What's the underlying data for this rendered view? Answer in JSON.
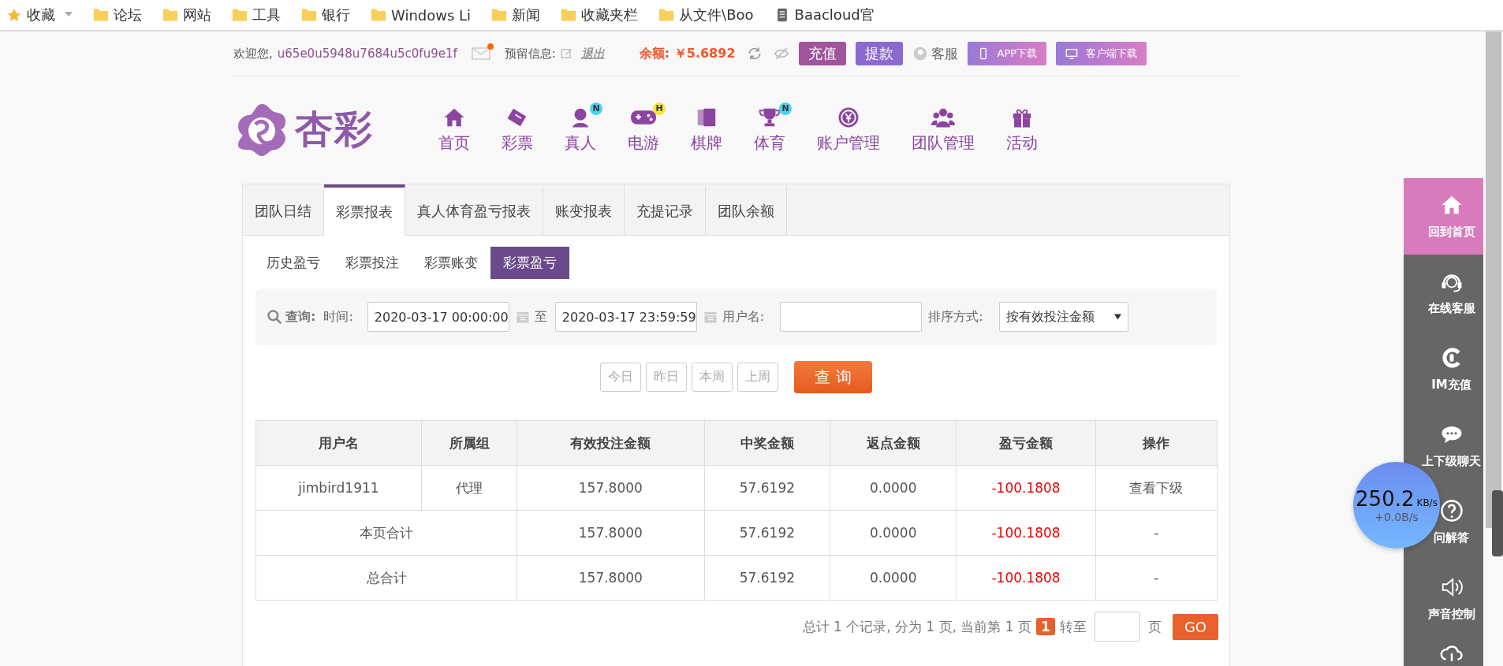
{
  "bookmarks_bar": {
    "items": [
      {
        "label": "收藏",
        "kind": "star"
      },
      {
        "label": "论坛",
        "kind": "folder"
      },
      {
        "label": "网站",
        "kind": "folder"
      },
      {
        "label": "工具",
        "kind": "folder"
      },
      {
        "label": "银行",
        "kind": "folder"
      },
      {
        "label": "Windows Li",
        "kind": "folder"
      },
      {
        "label": "新闻",
        "kind": "folder"
      },
      {
        "label": "收藏夹栏",
        "kind": "folder"
      },
      {
        "label": "从文件\\Boo",
        "kind": "folder"
      },
      {
        "label": "Baacloud官",
        "kind": "page"
      }
    ]
  },
  "top_bar": {
    "welcome": "欢迎您,",
    "username": "u65e0u5948u7684u5c0fu9e1f",
    "mail_unread": true,
    "reserved_label": "预留信息:",
    "logout": "退出",
    "balance_label": "余额:",
    "balance": "￥5.6892",
    "buttons": [
      {
        "label": "充值",
        "kind": "recharge"
      },
      {
        "label": "提款",
        "kind": "withdraw"
      }
    ],
    "service": "客服",
    "downloads": [
      {
        "label": "APP下载",
        "kind": "phone"
      },
      {
        "label": "客户端下载",
        "kind": "desktop"
      }
    ]
  },
  "nav": {
    "logo": "杏彩",
    "items": [
      {
        "label": "首页"
      },
      {
        "label": "彩票"
      },
      {
        "label": "真人",
        "badge": "N"
      },
      {
        "label": "电游",
        "badge": "H"
      },
      {
        "label": "棋牌"
      },
      {
        "label": "体育",
        "badge": "N"
      },
      {
        "label": "账户管理"
      },
      {
        "label": "团队管理"
      },
      {
        "label": "活动"
      }
    ]
  },
  "tabs": [
    {
      "label": "团队日结",
      "selected": false
    },
    {
      "label": "彩票报表",
      "selected": true
    },
    {
      "label": "真人体育盈亏报表",
      "selected": false
    },
    {
      "label": "账变报表",
      "selected": false
    },
    {
      "label": "充提记录",
      "selected": false
    },
    {
      "label": "团队余额",
      "selected": false
    }
  ],
  "subtabs": [
    {
      "label": "历史盈亏",
      "selected": false
    },
    {
      "label": "彩票投注",
      "selected": false
    },
    {
      "label": "彩票账变",
      "selected": false
    },
    {
      "label": "彩票盈亏",
      "selected": true
    }
  ],
  "filter": {
    "search_label": "查询:",
    "time_label": "时间:",
    "start": "2020-03-17 00:00:00",
    "to": "至",
    "end": "2020-03-17 23:59:59",
    "username_label": "用户名:",
    "sort_label": "排序方式:",
    "sort_value": "按有效投注金额"
  },
  "quick_buttons": [
    "今日",
    "昨日",
    "本周",
    "上周"
  ],
  "query_button": "查 询",
  "table": {
    "columns": [
      "用户名",
      "所属组",
      "有效投注金额",
      "中奖金额",
      "返点金额",
      "盈亏金额",
      "操作"
    ],
    "rows": [
      {
        "kind": "data",
        "cells": [
          "jimbird1911",
          "代理",
          "157.8000",
          "57.6192",
          "0.0000",
          "-100.1808",
          "查看下级"
        ]
      },
      {
        "kind": "total",
        "label": "本页合计",
        "cells": [
          "157.8000",
          "57.6192",
          "0.0000",
          "-100.1808",
          "-"
        ]
      },
      {
        "kind": "total",
        "label": "总合计",
        "cells": [
          "157.8000",
          "57.6192",
          "0.0000",
          "-100.1808",
          "-"
        ]
      }
    ]
  },
  "pagination": {
    "summary": "总计 1 个记录, 分为 1 页, 当前第 1 页",
    "current": "1",
    "goto": "转至",
    "unit": "页",
    "go": "GO"
  },
  "side_nav": [
    {
      "label": "回到首页",
      "selected": true
    },
    {
      "label": "在线客服",
      "selected": false
    },
    {
      "label": "IM充值",
      "selected": false
    },
    {
      "label": "上下级聊天",
      "selected": false
    },
    {
      "label": "问解答",
      "selected": false
    },
    {
      "label": "声音控制",
      "selected": false
    },
    {
      "selected": false
    }
  ],
  "net_widget": {
    "speed": "250.2",
    "unit": "KB/s",
    "upload": "+0.0B/s"
  }
}
